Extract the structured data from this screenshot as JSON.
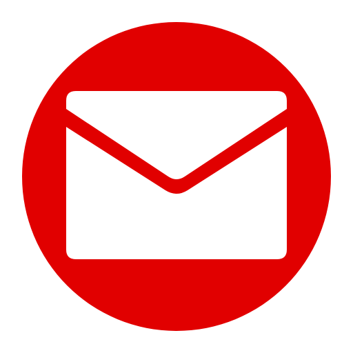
{
  "icon": {
    "name": "mail-envelope-icon",
    "background_color": "#E10000",
    "envelope_color": "#FFFFFF"
  }
}
